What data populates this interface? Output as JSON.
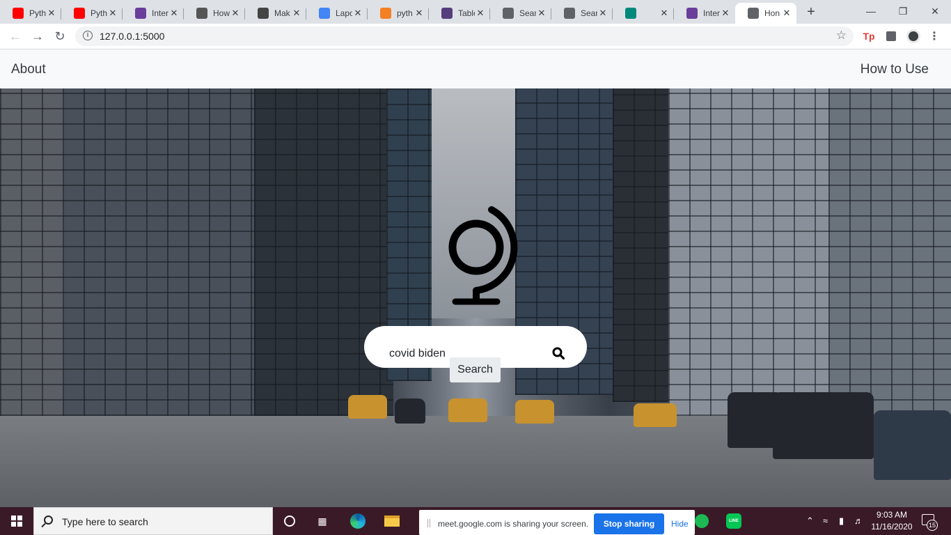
{
  "browser": {
    "tabs": [
      {
        "title": "Pyth",
        "favicon": "youtube-icon",
        "color": "#ff0000"
      },
      {
        "title": "Pyth",
        "favicon": "youtube-icon",
        "color": "#ff0000"
      },
      {
        "title": "Inter",
        "favicon": "nbc-icon",
        "color": "#6a3d9a"
      },
      {
        "title": "How",
        "favicon": "code-icon",
        "color": "#555555"
      },
      {
        "title": "Mak",
        "favicon": "table-icon",
        "color": "#444444"
      },
      {
        "title": "Lapo",
        "favicon": "docs-icon",
        "color": "#4285f4"
      },
      {
        "title": "pyth",
        "favicon": "stackoverflow-icon",
        "color": "#f48024"
      },
      {
        "title": "Table",
        "favicon": "bootstrap-icon",
        "color": "#563d7c"
      },
      {
        "title": "Sear",
        "favicon": "globe-icon",
        "color": "#5f6368"
      },
      {
        "title": "Sear",
        "favicon": "globe-icon",
        "color": "#5f6368"
      },
      {
        "title": "",
        "favicon": "meet-icon",
        "color": "#00897b"
      },
      {
        "title": "Inter",
        "favicon": "nbc-icon",
        "color": "#6a3d9a"
      },
      {
        "title": "Hon",
        "favicon": "globe-icon",
        "color": "#5f6368"
      }
    ],
    "new_tab": "+",
    "url": "127.0.0.1:5000",
    "ext_tp": "Tp"
  },
  "site": {
    "nav_about": "About",
    "nav_howto": "How to Use",
    "search_query": "covid biden",
    "search_button": "Search"
  },
  "taskbar": {
    "search_placeholder": "Type here to search",
    "share_message": "meet.google.com is sharing your screen.",
    "stop_sharing": "Stop sharing",
    "hide": "Hide",
    "time": "9:03 AM",
    "date": "11/16/2020",
    "notifications": "15"
  }
}
